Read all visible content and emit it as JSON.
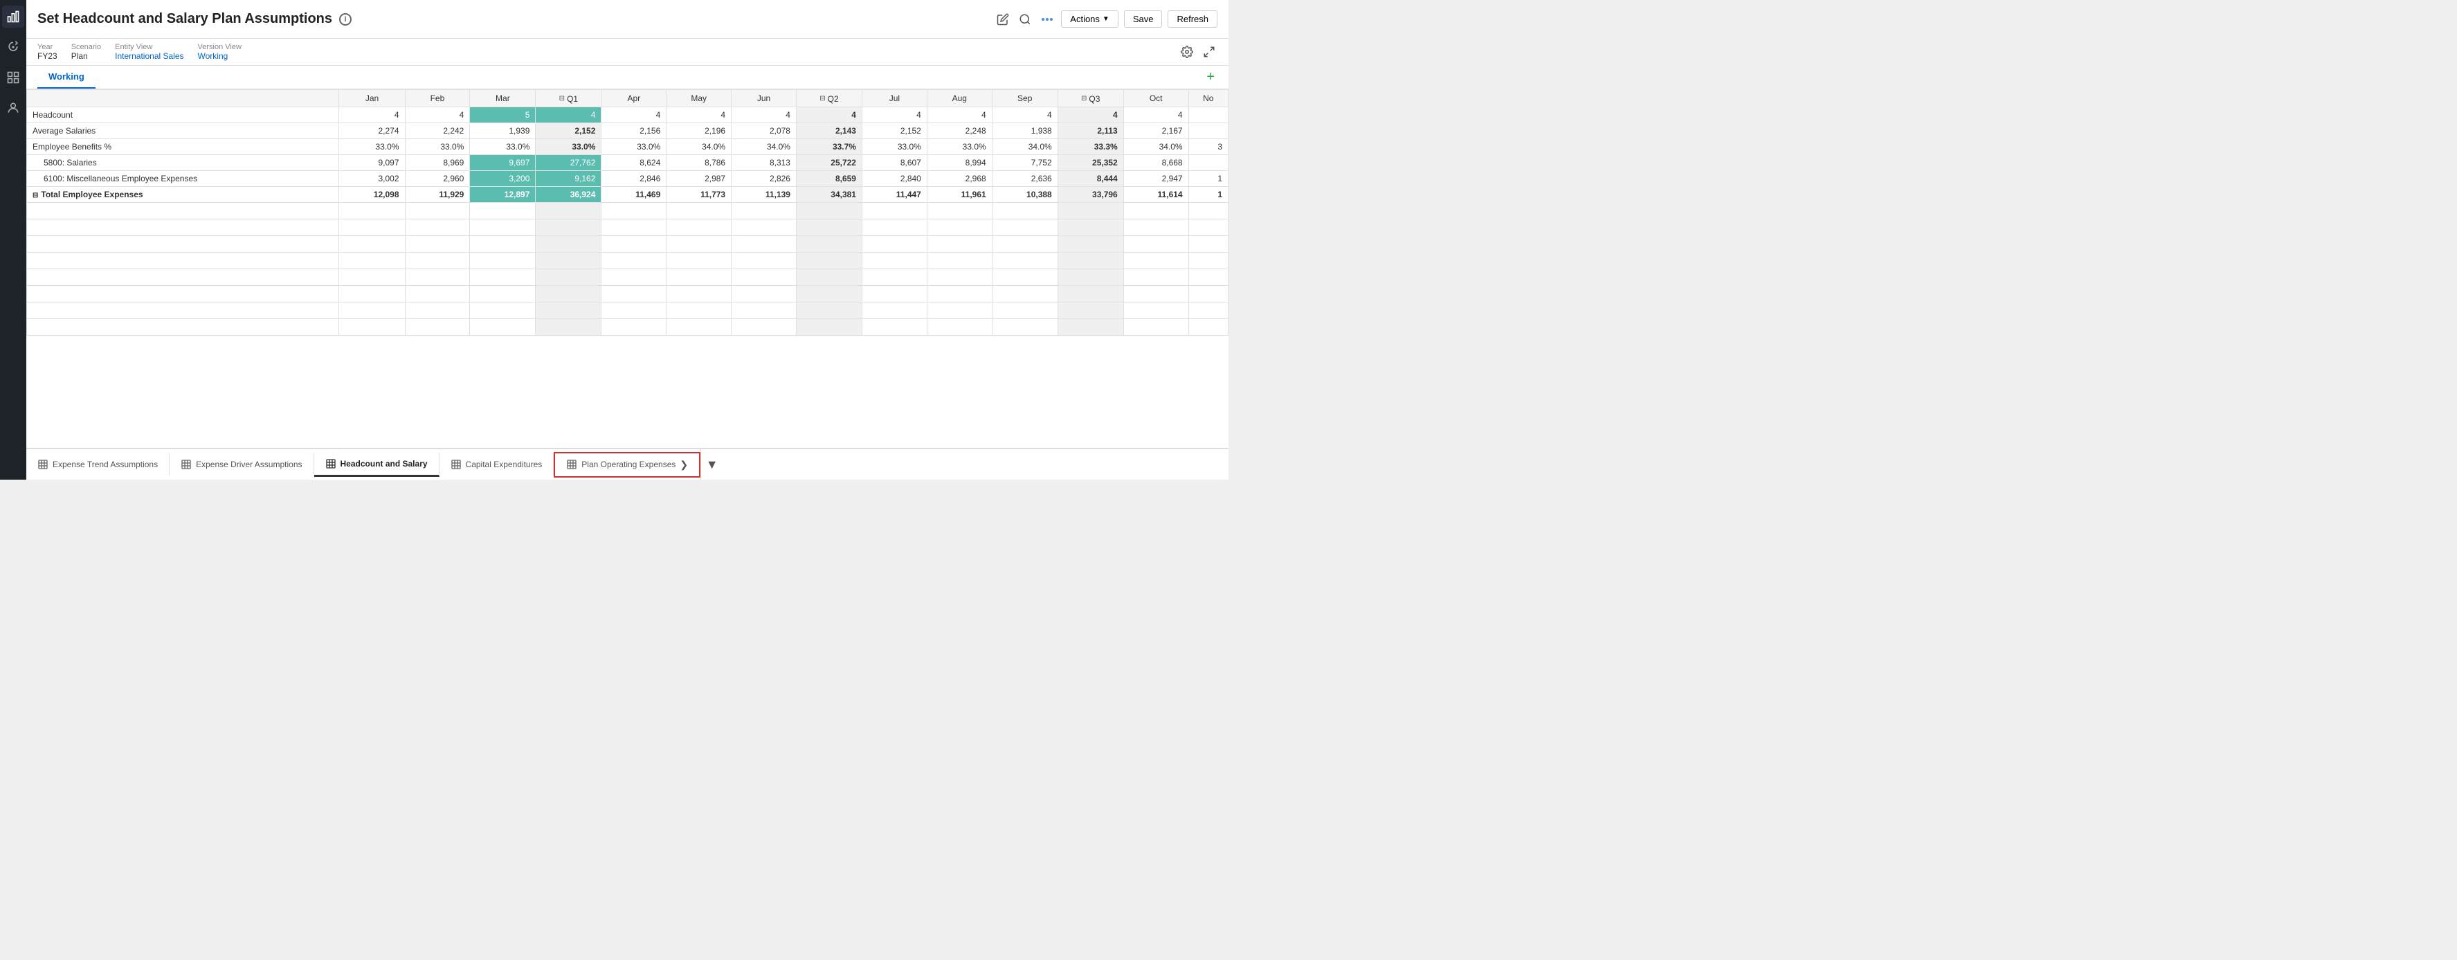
{
  "header": {
    "title": "Set Headcount and Salary Plan Assumptions",
    "actions_label": "Actions",
    "save_label": "Save",
    "refresh_label": "Refresh"
  },
  "context": {
    "year_label": "Year",
    "year_value": "FY23",
    "scenario_label": "Scenario",
    "scenario_value": "Plan",
    "entity_label": "Entity View",
    "entity_value": "International Sales",
    "version_label": "Version View",
    "version_value": "Working"
  },
  "tabs": [
    {
      "label": "Working",
      "active": true
    }
  ],
  "columns": {
    "label_col": "",
    "months": [
      "Jan",
      "Feb",
      "Mar",
      "Q1",
      "Apr",
      "May",
      "Jun",
      "Q2",
      "Jul",
      "Aug",
      "Sep",
      "Q3",
      "Oct",
      "No"
    ]
  },
  "rows": [
    {
      "label": "Headcount",
      "values": [
        "4",
        "4",
        "5",
        "4",
        "4",
        "4",
        "4",
        "4",
        "4",
        "4",
        "4",
        "4",
        "4",
        ""
      ],
      "highlight_cols": [
        2,
        3
      ]
    },
    {
      "label": "Average Salaries",
      "values": [
        "2,274",
        "2,242",
        "1,939",
        "2,152",
        "2,156",
        "2,196",
        "2,078",
        "2,143",
        "2,152",
        "2,248",
        "1,938",
        "2,113",
        "2,167",
        ""
      ],
      "highlight_cols": []
    },
    {
      "label": "Employee Benefits %",
      "values": [
        "33.0%",
        "33.0%",
        "33.0%",
        "33.0%",
        "33.0%",
        "34.0%",
        "34.0%",
        "33.7%",
        "33.0%",
        "33.0%",
        "34.0%",
        "33.3%",
        "34.0%",
        "3"
      ],
      "highlight_cols": []
    },
    {
      "label": "5800: Salaries",
      "values": [
        "9,097",
        "8,969",
        "9,697",
        "27,762",
        "8,624",
        "8,786",
        "8,313",
        "25,722",
        "8,607",
        "8,994",
        "7,752",
        "25,352",
        "8,668",
        ""
      ],
      "highlight_cols": [
        2,
        3
      ],
      "indent": true
    },
    {
      "label": "6100: Miscellaneous Employee Expenses",
      "values": [
        "3,002",
        "2,960",
        "3,200",
        "9,162",
        "2,846",
        "2,987",
        "2,826",
        "8,659",
        "2,840",
        "2,968",
        "2,636",
        "8,444",
        "2,947",
        "1"
      ],
      "highlight_cols": [
        2,
        3
      ],
      "indent": true
    },
    {
      "label": "Total Employee Expenses",
      "values": [
        "12,098",
        "11,929",
        "12,897",
        "36,924",
        "11,469",
        "11,773",
        "11,139",
        "34,381",
        "11,447",
        "11,961",
        "10,388",
        "33,796",
        "11,614",
        "1"
      ],
      "highlight_cols": [
        2,
        3
      ],
      "bold": true,
      "expandable": true
    }
  ],
  "empty_rows": 8,
  "bottom_tabs": [
    {
      "label": "Expense Trend Assumptions",
      "active": false
    },
    {
      "label": "Expense Driver Assumptions",
      "active": false
    },
    {
      "label": "Headcount and Salary",
      "active": true
    },
    {
      "label": "Capital Expenditures",
      "active": false
    },
    {
      "label": "Plan Operating Expenses",
      "active": false,
      "highlighted": true
    }
  ],
  "quarter_cols": [
    3,
    7,
    11
  ],
  "colors": {
    "teal_highlight": "#5bbcb0",
    "teal_light": "#7dccc5",
    "accent_blue": "#0066cc",
    "active_tab_border": "#333",
    "highlight_border": "#cc3333"
  }
}
